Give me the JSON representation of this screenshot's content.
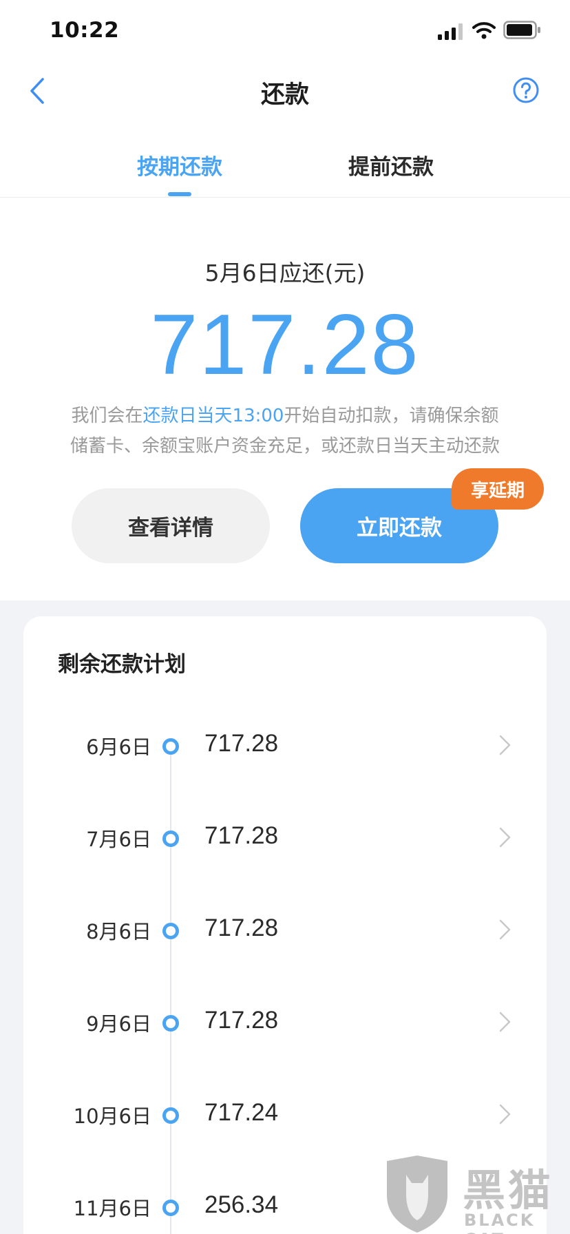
{
  "status_bar": {
    "time": "10:22"
  },
  "nav": {
    "title": "还款"
  },
  "tabs": [
    {
      "label": "按期还款",
      "active": true
    },
    {
      "label": "提前还款",
      "active": false
    }
  ],
  "due": {
    "label": "5月6日应还(元)",
    "amount": "717.28",
    "notice_part1": "我们会在",
    "notice_highlight": "还款日当天13:00",
    "notice_part2": "开始自动扣款，请确保余额",
    "notice_line2": "储蓄卡、余额宝账户资金充足，或还款日当天主动还款"
  },
  "actions": {
    "detail_label": "查看详情",
    "pay_label": "立即还款",
    "badge_label": "享延期"
  },
  "plan": {
    "title": "剩余还款计划",
    "items": [
      {
        "date": "6月6日",
        "amount": "717.28"
      },
      {
        "date": "7月6日",
        "amount": "717.28"
      },
      {
        "date": "8月6日",
        "amount": "717.28"
      },
      {
        "date": "9月6日",
        "amount": "717.28"
      },
      {
        "date": "10月6日",
        "amount": "717.24"
      },
      {
        "date": "11月6日",
        "amount": "256.34"
      }
    ]
  },
  "watermark": {
    "text_cn": "黑猫",
    "text_en": "BLACK CAT"
  },
  "colors": {
    "accent": "#4aa4f2",
    "badge": "#f07a2b",
    "background": "#f2f3f7"
  }
}
